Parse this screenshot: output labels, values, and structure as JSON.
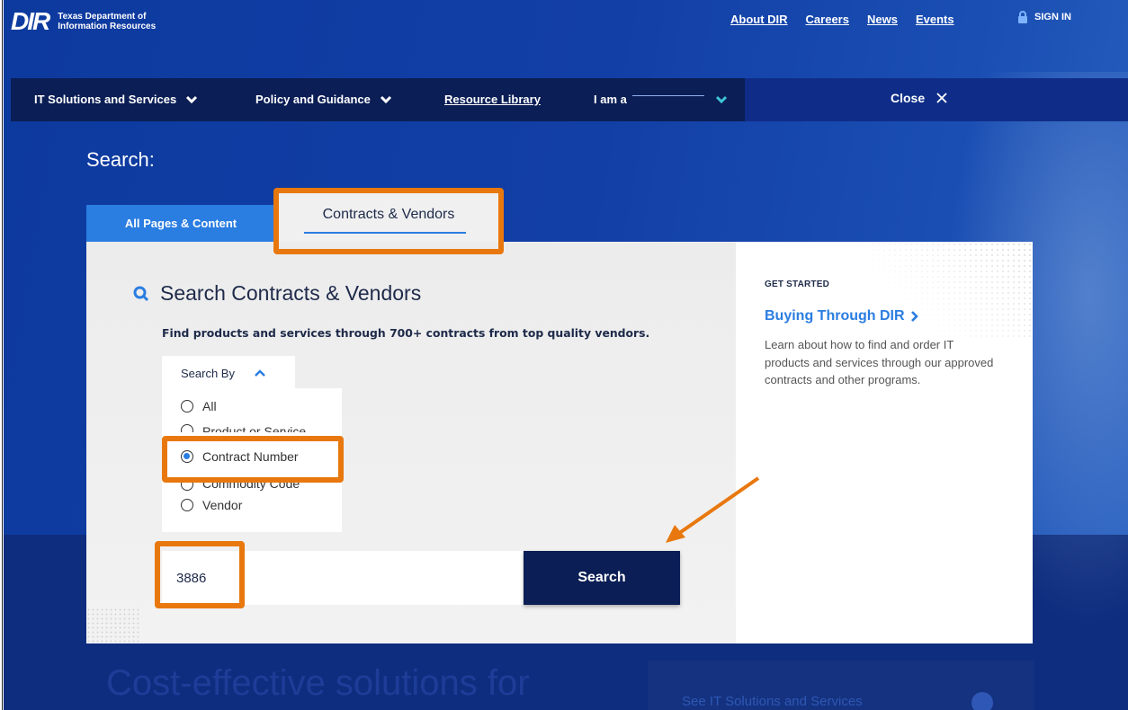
{
  "header": {
    "logo_mark": "DIR",
    "logo_text": "Texas Department of Information Resources",
    "utility_links": [
      "About DIR",
      "Careers",
      "News",
      "Events"
    ],
    "signin_label": "SIGN IN"
  },
  "main_nav": {
    "items": [
      {
        "label": "IT Solutions and Services"
      },
      {
        "label": "Policy and Guidance"
      },
      {
        "label": "Resource Library"
      },
      {
        "label": "I am a"
      }
    ],
    "close_label": "Close"
  },
  "search": {
    "heading": "Search:",
    "tabs": [
      {
        "label": "All Pages & Content"
      },
      {
        "label": "Contracts & Vendors",
        "active": true
      }
    ],
    "title": "Search Contracts & Vendors",
    "subtitle": "Find products and services through 700+ contracts from top quality vendors.",
    "search_by_label": "Search By",
    "options": [
      {
        "label": "All",
        "checked": false
      },
      {
        "label": "Product or Service",
        "checked": false
      },
      {
        "label": "Contract Number",
        "checked": true
      },
      {
        "label": "Commodity Code",
        "checked": false
      },
      {
        "label": "Vendor",
        "checked": false
      }
    ],
    "input_value": "3886",
    "button_label": "Search"
  },
  "get_started": {
    "label": "GET STARTED",
    "link": "Buying Through DIR",
    "description": "Learn about how to find and order IT products and services through our approved contracts and other programs."
  },
  "below": {
    "heading": "Cost-effective solutions for",
    "link": "See IT Solutions and Services"
  },
  "colors": {
    "highlight": "#e8780e",
    "accent_blue": "#2a7de1",
    "navy": "#0b1e55"
  }
}
